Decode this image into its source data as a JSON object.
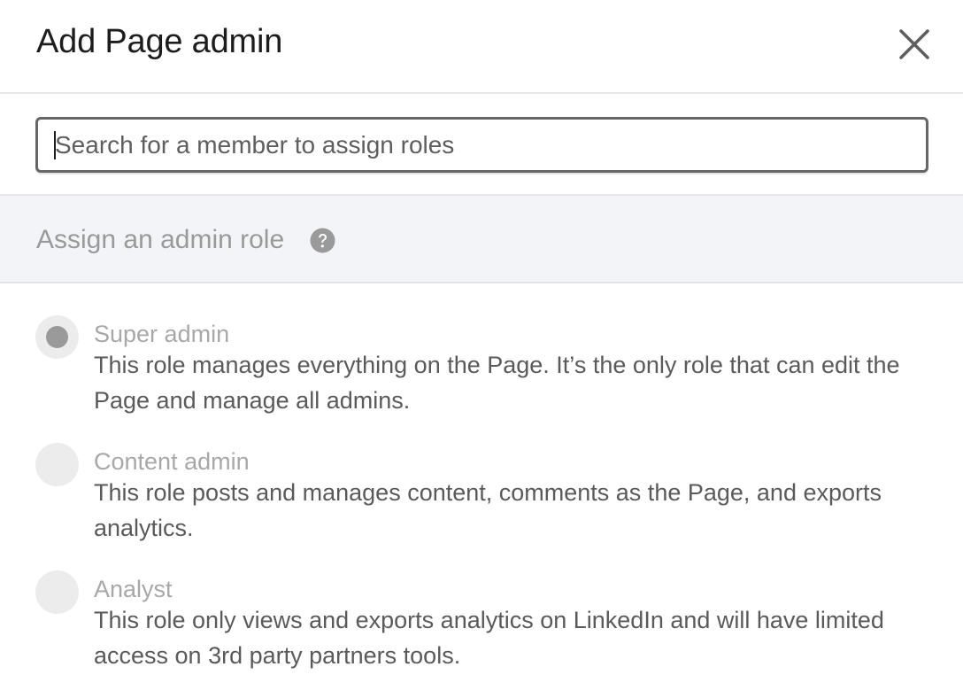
{
  "dialog": {
    "title": "Add Page admin",
    "close_icon": "close-icon"
  },
  "search": {
    "placeholder": "Search for a member to assign roles",
    "value": ""
  },
  "role_section": {
    "heading": "Assign an admin role",
    "help_icon": "question-circle-icon"
  },
  "roles": [
    {
      "name": "Super admin",
      "description": "This role manages everything on the Page. It’s the only role that can edit the Page and manage all admins.",
      "selected": true
    },
    {
      "name": "Content admin",
      "description": "This role posts and manages content, comments as the Page, and exports analytics.",
      "selected": false
    },
    {
      "name": "Analyst",
      "description": "This role only views and exports analytics on LinkedIn and will have limited access on 3rd party partners tools.",
      "selected": false
    }
  ],
  "colors": {
    "border": "#666666",
    "section_bg": "#f3f4f8",
    "disabled_text": "#a8a8a8",
    "body_text": "#5a5a5a"
  }
}
